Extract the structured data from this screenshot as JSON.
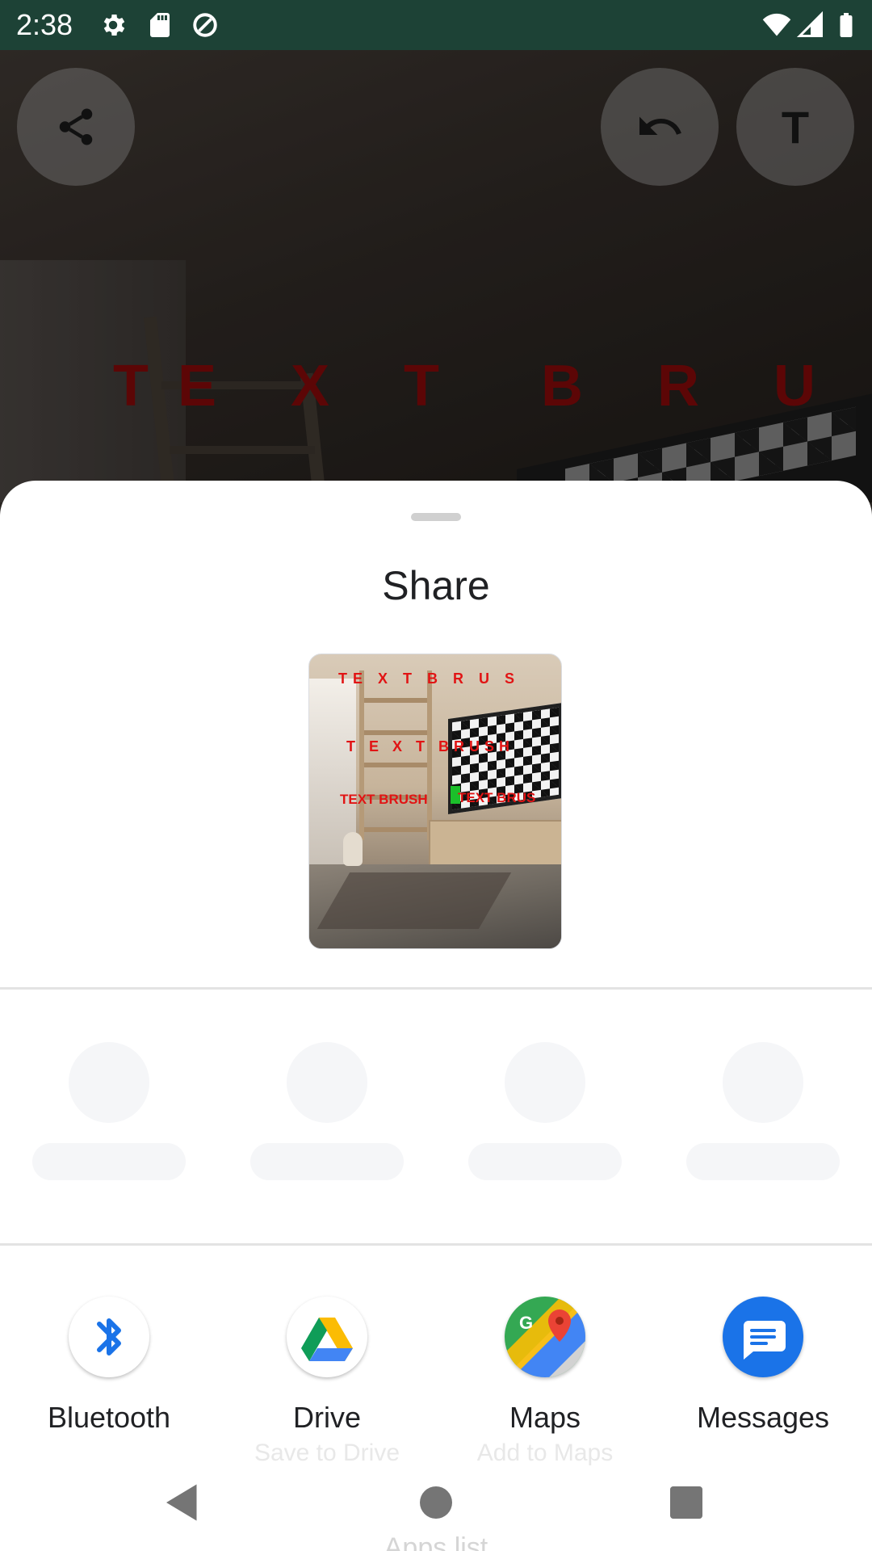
{
  "status_bar": {
    "time": "2:38",
    "left_icons": [
      "gear-icon",
      "sd-card-icon",
      "data-saver-icon"
    ],
    "right_icons": [
      "wifi-icon",
      "signal-icon",
      "battery-icon"
    ]
  },
  "editor": {
    "overlay_text": {
      "part1": "TE X T",
      "part2": "B R U S",
      "color": "#5c0606"
    },
    "buttons": {
      "share": "share-icon",
      "undo": "undo-icon",
      "text": "T"
    }
  },
  "share_sheet": {
    "title": "Share",
    "preview_texts": {
      "line1": "TE X T   B R U S",
      "line2": "T E X T  BRUSH",
      "line3a": "TEXT  BRUSH",
      "line3b": "TEXT  BRUS"
    },
    "apps": [
      {
        "label": "Bluetooth",
        "sub": "",
        "icon": "bluetooth-icon"
      },
      {
        "label": "Drive",
        "sub": "Save to Drive",
        "icon": "drive-icon"
      },
      {
        "label": "Maps",
        "sub": "Add to Maps",
        "icon": "maps-icon"
      },
      {
        "label": "Messages",
        "sub": "",
        "icon": "messages-icon"
      }
    ],
    "app_list_label": "Apps list"
  },
  "nav_bar": {
    "back": "back-icon",
    "home": "home-icon",
    "recents": "recents-icon"
  },
  "colors": {
    "status_bar": "#1d4236",
    "sheet_background": "#ffffff",
    "messages_blue": "#1a73e8",
    "bluetooth_blue": "#1a73e8"
  }
}
